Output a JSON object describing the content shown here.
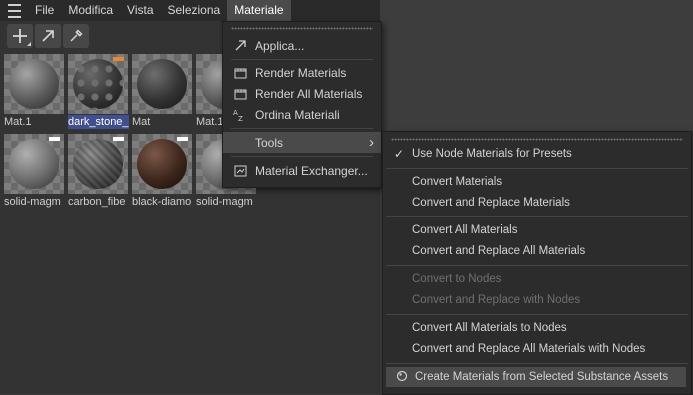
{
  "menubar": {
    "items": [
      "File",
      "Modifica",
      "Vista",
      "Seleziona",
      "Materiale"
    ],
    "active": "Materiale"
  },
  "toolbar": {
    "icons": [
      "plus-icon",
      "arrow-icon",
      "eyedropper-icon"
    ]
  },
  "materials": [
    {
      "label": "Mat.1",
      "sphere": "stone-grey",
      "flag": ""
    },
    {
      "label": "dark_stone_",
      "sphere": "dark-stone",
      "flag": "#e88a2c",
      "selected": true
    },
    {
      "label": "Mat",
      "sphere": "plain-dark",
      "flag": ""
    },
    {
      "label": "Mat.1",
      "sphere": "stone-grey",
      "flag": ""
    },
    {
      "label": "solid-magm",
      "sphere": "magma-grey",
      "flag": "#ffffff"
    },
    {
      "label": "carbon_fibe",
      "sphere": "carbon",
      "flag": "#ffffff"
    },
    {
      "label": "black-diamo",
      "sphere": "brown-leather",
      "flag": "#ffffff"
    },
    {
      "label": "solid-magm",
      "sphere": "magma-grey",
      "flag": "#ffffff"
    }
  ],
  "materiale_menu": {
    "applica": "Applica...",
    "render_materials": "Render Materials",
    "render_all_materials": "Render All Materials",
    "ordina_materiali": "Ordina Materiali",
    "tools": "Tools",
    "tools_arrow": "›",
    "material_exchanger": "Material Exchanger..."
  },
  "tools_menu": {
    "checkmark": "✓",
    "use_node_materials": "Use Node Materials for Presets",
    "convert_materials": "Convert Materials",
    "convert_replace_materials": "Convert and Replace Materials",
    "convert_all_materials": "Convert All Materials",
    "convert_replace_all_materials": "Convert and Replace All Materials",
    "convert_to_nodes": "Convert to Nodes",
    "convert_replace_with_nodes": "Convert and Replace with Nodes",
    "convert_all_to_nodes": "Convert All Materials to Nodes",
    "convert_replace_all_with_nodes": "Convert and Replace All Materials with Nodes",
    "create_from_substance": "Create Materials from Selected Substance Assets"
  },
  "colors": {
    "menubar_bg": "#2a2a2a",
    "menu_bg": "#2c2c2c",
    "highlight": "#4a4a4a",
    "selection": "#3f4f8f",
    "orange_flag": "#e88a2c"
  }
}
